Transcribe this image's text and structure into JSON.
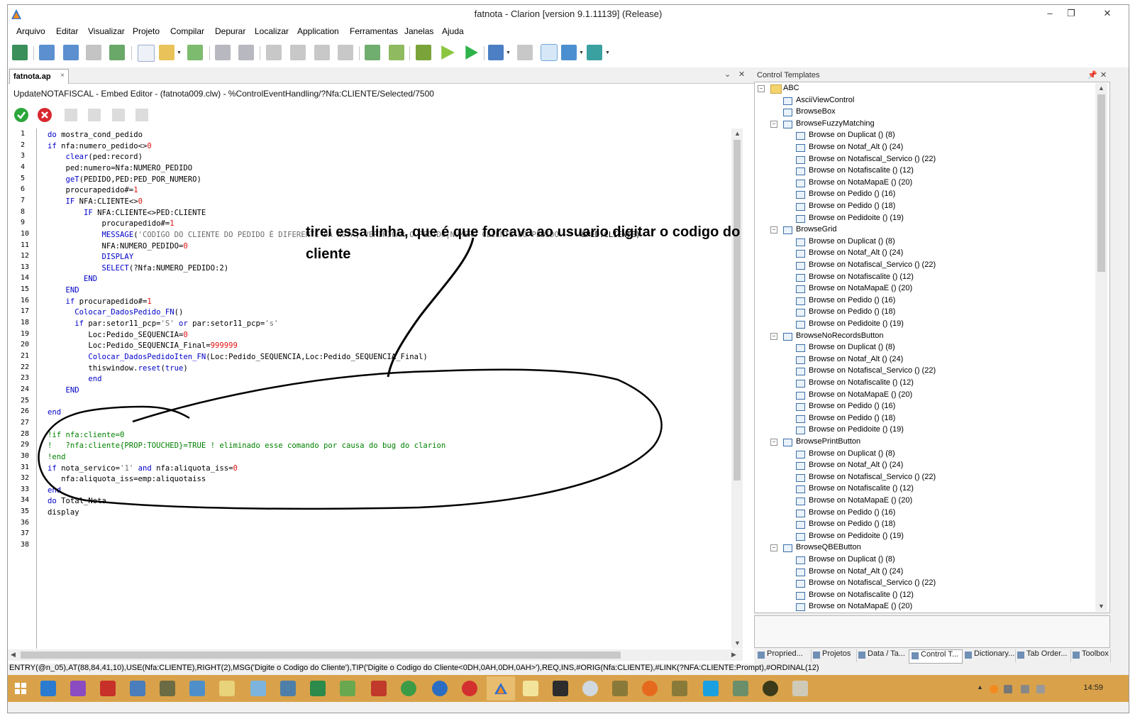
{
  "window": {
    "title": "fatnota - Clarion [version 9.1.11139] (Release)",
    "controls": {
      "minimize": "–",
      "restore": "❐",
      "close": "✕"
    }
  },
  "menu": [
    "Arquivo",
    "Editar",
    "Visualizar",
    "Projeto",
    "Compilar",
    "Depurar",
    "Localizar",
    "Application",
    "Ferramentas",
    "Janelas",
    "Ajuda"
  ],
  "editor": {
    "tab_label": "fatnota.ap",
    "tab_close": "×",
    "panel_controls": {
      "menu": "⌄",
      "close": "✕"
    },
    "embed_title": "UpdateNOTAFISCAL - Embed Editor - (fatnota009.clw) - %ControlEventHandling/?Nfa:CLIENTE/Selected/7500",
    "line_count": 38,
    "annotation": "tirei essa linha, que é que forcava ao usuario digitar o codigo do cliente"
  },
  "code_lines": [
    [
      [
        "kw",
        "do"
      ],
      [
        "id",
        " mostra_cond_pedido"
      ]
    ],
    [
      [
        "kw",
        "if"
      ],
      [
        "id",
        " nfa:numero_pedido<>"
      ],
      [
        "num",
        "0"
      ]
    ],
    [
      [
        "id",
        "    "
      ],
      [
        "kw",
        "clear"
      ],
      [
        "id",
        "(ped:record)"
      ]
    ],
    [
      [
        "id",
        "    ped:numero=Nfa:NUMERO_PEDIDO"
      ]
    ],
    [
      [
        "id",
        "    "
      ],
      [
        "kw",
        "geT"
      ],
      [
        "id",
        "(PEDIDO,PED:PED_POR_NUMERO)"
      ]
    ],
    [
      [
        "id",
        "    procurapedido#="
      ],
      [
        "num",
        "1"
      ]
    ],
    [
      [
        "id",
        "    "
      ],
      [
        "kw",
        "IF"
      ],
      [
        "id",
        " NFA:CLIENTE<>"
      ],
      [
        "num",
        "0"
      ]
    ],
    [
      [
        "id",
        "        "
      ],
      [
        "kw",
        "IF"
      ],
      [
        "id",
        " NFA:CLIENTE<>PED:CLIENTE"
      ]
    ],
    [
      [
        "id",
        "            procurapedido#="
      ],
      [
        "num",
        "1"
      ]
    ],
    [
      [
        "id",
        "            "
      ],
      [
        "kw",
        "MESSAGE"
      ],
      [
        "id",
        "("
      ],
      [
        "str",
        "'CODIGO DO CLIENTE DO PEDIDO É DIFERENTE DA NOTA, VERIFICAR O PEDIDO|NUMERO CLIENTE DO PEDIDO -> '"
      ],
      [
        "id",
        "&PED:CLIENTE)"
      ]
    ],
    [
      [
        "id",
        "            NFA:NUMERO_PEDIDO="
      ],
      [
        "num",
        "0"
      ]
    ],
    [
      [
        "id",
        "            "
      ],
      [
        "kw",
        "DISPLAY"
      ]
    ],
    [
      [
        "id",
        "            "
      ],
      [
        "kw",
        "SELECT"
      ],
      [
        "id",
        "(?Nfa:NUMERO_PEDIDO:2)"
      ]
    ],
    [
      [
        "id",
        "        "
      ],
      [
        "kw",
        "END"
      ]
    ],
    [
      [
        "id",
        "    "
      ],
      [
        "kw",
        "END"
      ]
    ],
    [
      [
        "id",
        "    "
      ],
      [
        "kw",
        "if"
      ],
      [
        "id",
        " procurapedido#="
      ],
      [
        "num",
        "1"
      ]
    ],
    [
      [
        "id",
        "      "
      ],
      [
        "kw",
        "Colocar_DadosPedido_FN"
      ],
      [
        "id",
        "()"
      ]
    ],
    [
      [
        "id",
        "      "
      ],
      [
        "kw",
        "if"
      ],
      [
        "id",
        " par:setor11_pcp="
      ],
      [
        "str",
        "'S'"
      ],
      [
        "id",
        " "
      ],
      [
        "kw",
        "or"
      ],
      [
        "id",
        " par:setor11_pcp="
      ],
      [
        "str",
        "'s'"
      ]
    ],
    [
      [
        "id",
        "         Loc:Pedido_SEQUENCIA="
      ],
      [
        "num",
        "0"
      ]
    ],
    [
      [
        "id",
        "         Loc:Pedido_SEQUENCIA_Final="
      ],
      [
        "num",
        "999999"
      ]
    ],
    [
      [
        "id",
        "         "
      ],
      [
        "kw",
        "Colocar_DadosPedidoIten_FN"
      ],
      [
        "id",
        "(Loc:Pedido_SEQUENCIA,Loc:Pedido_SEQUENCIA_Final)"
      ]
    ],
    [
      [
        "id",
        "         thiswindow."
      ],
      [
        "kw",
        "reset"
      ],
      [
        "id",
        "("
      ],
      [
        "kw",
        "true"
      ],
      [
        "id",
        ")"
      ]
    ],
    [
      [
        "id",
        "         "
      ],
      [
        "kw",
        "end"
      ]
    ],
    [
      [
        "id",
        "    "
      ],
      [
        "kw",
        "END"
      ]
    ],
    [],
    [
      [
        "kw",
        "end"
      ]
    ],
    [],
    [
      [
        "cmt",
        "!if nfa:cliente=0"
      ]
    ],
    [
      [
        "cmt",
        "!   ?nfa:cliente{PROP:TOUCHED}=TRUE ! eliminado esse comando por causa do bug do clarion"
      ]
    ],
    [
      [
        "cmt",
        "!end"
      ]
    ],
    [
      [
        "kw",
        "if"
      ],
      [
        "id",
        " nota_servico="
      ],
      [
        "str",
        "'1'"
      ],
      [
        "id",
        " "
      ],
      [
        "kw",
        "and"
      ],
      [
        "id",
        " nfa:aliquota_iss="
      ],
      [
        "num",
        "0"
      ]
    ],
    [
      [
        "id",
        "   nfa:aliquota_iss=emp:aliquotaiss"
      ]
    ],
    [
      [
        "kw",
        "end"
      ]
    ],
    [
      [
        "kw",
        "do"
      ],
      [
        "id",
        " Total_Nota"
      ]
    ],
    [
      [
        "id",
        "display"
      ]
    ],
    [],
    [],
    []
  ],
  "control_templates": {
    "title": "Control Templates",
    "root": "ABC",
    "leaf_templates": [
      "AsciiViewControl",
      "BrowseBox"
    ],
    "groups": [
      {
        "name": "BrowseFuzzyMatching",
        "children": [
          "Browse on Duplicat () (8)",
          "Browse on Notaf_Alt () (24)",
          "Browse on Notafiscal_Servico () (22)",
          "Browse on Notafiscalite () (12)",
          "Browse on NotaMapaE () (20)",
          "Browse on Pedido () (16)",
          "Browse on Pedido () (18)",
          "Browse on Pedidoite () (19)"
        ]
      },
      {
        "name": "BrowseGrid",
        "children": [
          "Browse on Duplicat () (8)",
          "Browse on Notaf_Alt () (24)",
          "Browse on Notafiscal_Servico () (22)",
          "Browse on Notafiscalite () (12)",
          "Browse on NotaMapaE () (20)",
          "Browse on Pedido () (16)",
          "Browse on Pedido () (18)",
          "Browse on Pedidoite () (19)"
        ]
      },
      {
        "name": "BrowseNoRecordsButton",
        "children": [
          "Browse on Duplicat () (8)",
          "Browse on Notaf_Alt () (24)",
          "Browse on Notafiscal_Servico () (22)",
          "Browse on Notafiscalite () (12)",
          "Browse on NotaMapaE () (20)",
          "Browse on Pedido () (16)",
          "Browse on Pedido () (18)",
          "Browse on Pedidoite () (19)"
        ]
      },
      {
        "name": "BrowsePrintButton",
        "children": [
          "Browse on Duplicat () (8)",
          "Browse on Notaf_Alt () (24)",
          "Browse on Notafiscal_Servico () (22)",
          "Browse on Notafiscalite () (12)",
          "Browse on NotaMapaE () (20)",
          "Browse on Pedido () (16)",
          "Browse on Pedido () (18)",
          "Browse on Pedidoite () (19)"
        ]
      },
      {
        "name": "BrowseQBEButton",
        "children": [
          "Browse on Duplicat () (8)",
          "Browse on Notaf_Alt () (24)",
          "Browse on Notafiscal_Servico () (22)",
          "Browse on Notafiscalite () (12)",
          "Browse on NotaMapaE () (20)"
        ]
      }
    ]
  },
  "bottom_tabs": [
    {
      "label": "Propried...",
      "active": false
    },
    {
      "label": "Projetos",
      "active": false
    },
    {
      "label": "Data / Ta...",
      "active": false
    },
    {
      "label": "Control T...",
      "active": true
    },
    {
      "label": "Dictionary...",
      "active": false
    },
    {
      "label": "Tab Order...",
      "active": false
    },
    {
      "label": "Toolbox",
      "active": false
    }
  ],
  "status_text": "ENTRY(@n_05),AT(88,84,41,10),USE(Nfa:CLIENTE),RIGHT(2),MSG('Digite o Codigo do Cliente'),TIP('Digite o Codigo do Cliente<0DH,0AH,0DH,0AH>'),REQ,INS,#ORIG(Nfa:CLIENTE),#LINK(?NFA:CLIENTE:Prompt),#ORDINAL(12)",
  "taskbar": {
    "clock": "14:59"
  },
  "colors": {
    "keyword": "#0000c8",
    "number": "#e01010",
    "string": "#6b6b6b",
    "comment": "#008000",
    "taskbar": "#d9a24a"
  }
}
